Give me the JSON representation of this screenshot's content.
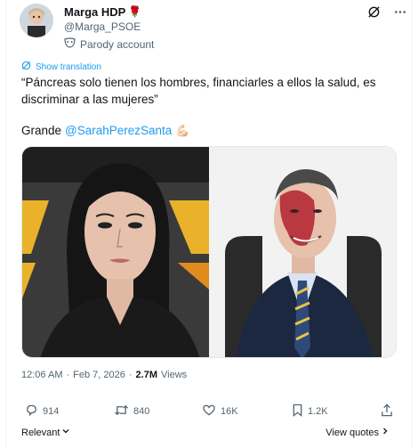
{
  "author": {
    "display_name": "Marga HDP",
    "name_emoji": "🌹",
    "handle": "@Marga_PSOE",
    "parody_label": "Parody account"
  },
  "translation_link": "Show translation",
  "tweet": {
    "line1": "“Páncreas solo tienen los hombres, financiarles a ellos la salud, es",
    "line2": "discriminar a las mujeres”",
    "grande_prefix": "Grande",
    "mention": "@SarahPerezSanta",
    "trailing_emoji": "💪🏻"
  },
  "meta": {
    "time": "12:06 AM",
    "separator": "·",
    "date": "Feb 7, 2026",
    "views_separator": "·",
    "views_count": "2.7M",
    "views_label": "Views"
  },
  "actions": {
    "replies": "914",
    "reposts": "840",
    "likes": "16K",
    "bookmarks": "1.2K"
  },
  "footer": {
    "relevant_label": "Relevant",
    "view_quotes_label": "View quotes"
  },
  "icons": {
    "grok": "grok-icon",
    "more": "more-icon",
    "parody": "parody-mask-icon",
    "translate": "translate-icon",
    "reply": "reply-icon",
    "repost": "repost-icon",
    "like": "like-icon",
    "bookmark": "bookmark-icon",
    "share": "share-icon"
  },
  "colors": {
    "accent": "#1d9bf0",
    "secondary_text": "#536471",
    "primary_text": "#0f1419"
  }
}
